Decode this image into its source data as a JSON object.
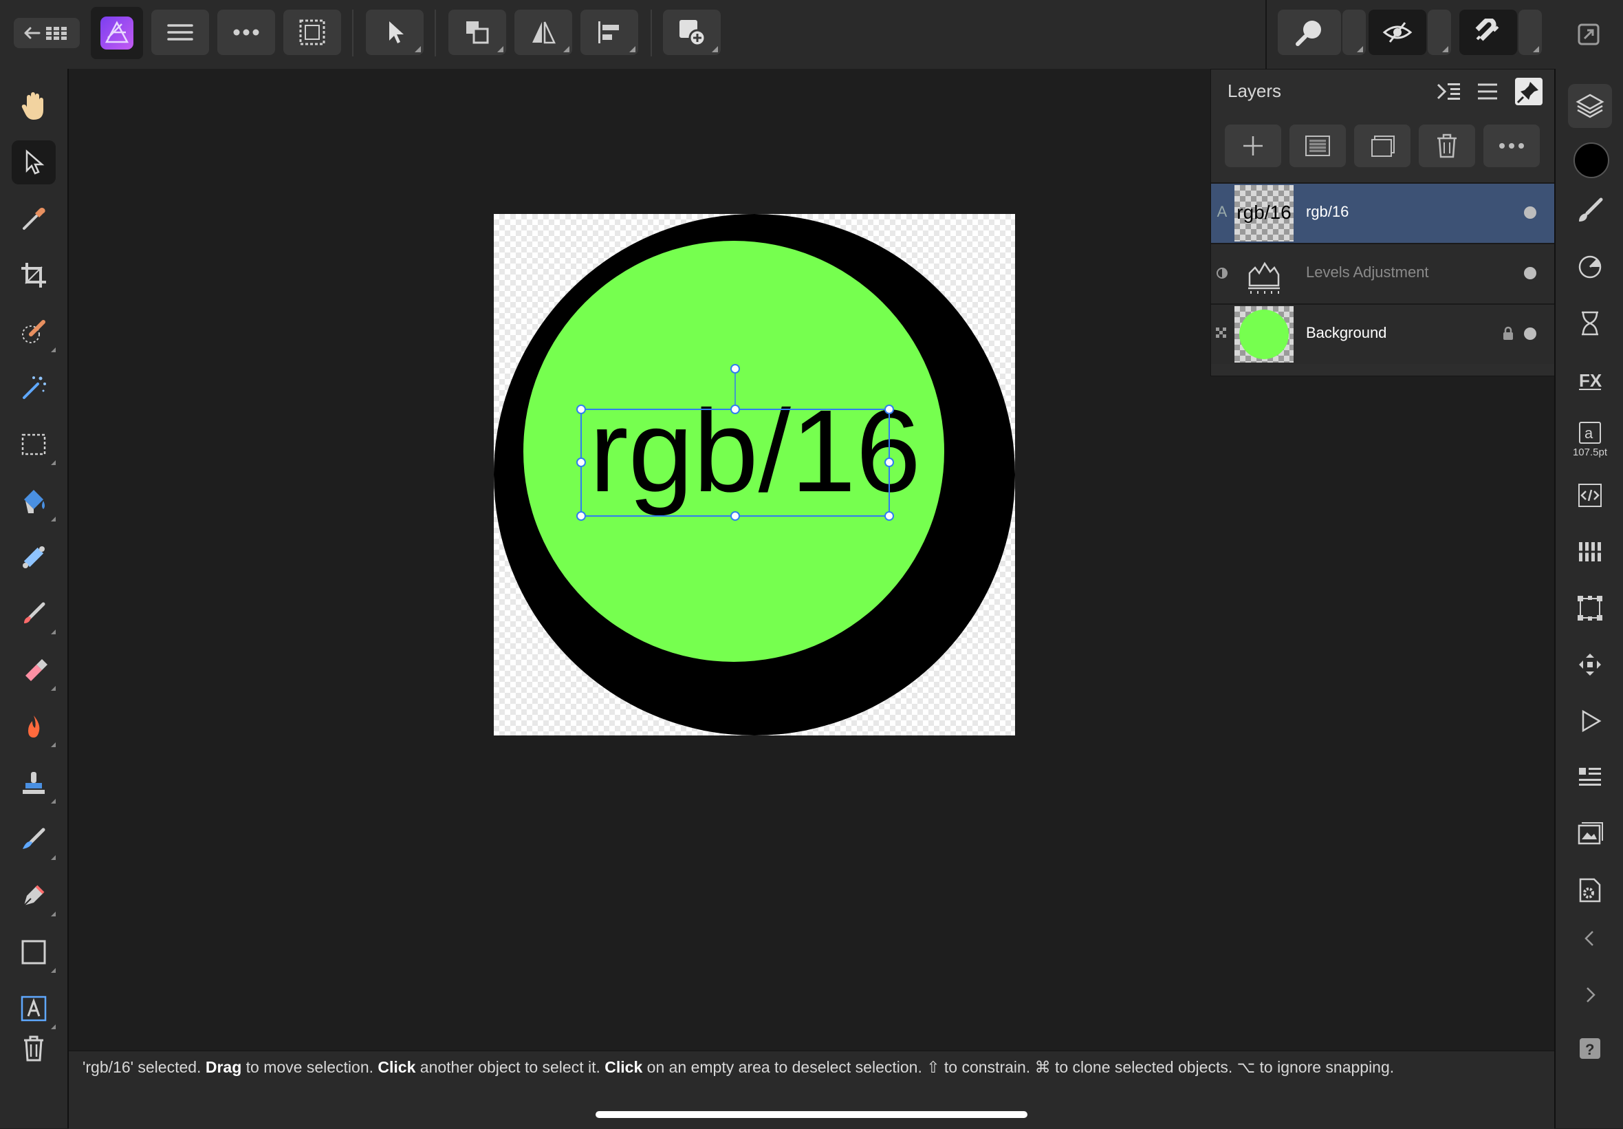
{
  "toolbar": {
    "right_groups": [
      "zoom-view",
      "view-quality",
      "snapping"
    ]
  },
  "tools_left": [
    "hand-icon",
    "move-tool-icon",
    "color-picker-icon",
    "crop-icon",
    "selection-brush-icon",
    "flood-select-icon",
    "marquee-icon",
    "flood-fill-icon",
    "gradient-icon",
    "paint-brush-icon",
    "erase-brush-icon",
    "dodge-icon",
    "clone-icon",
    "smudge-icon",
    "pen-icon",
    "rectangle-icon",
    "artistic-text-icon",
    "delete-icon"
  ],
  "studio_right": {
    "font_size": "107.5pt",
    "color_swatch": "#000000"
  },
  "layers_panel": {
    "title": "Layers",
    "layers": [
      {
        "name": "rgb/16",
        "type_badge": "A",
        "thumb_text": "rgb/16",
        "selected": true,
        "dim": false
      },
      {
        "name": "Levels Adjustment",
        "type_badge": "",
        "selected": false,
        "dim": true
      },
      {
        "name": "Background",
        "type_badge": "",
        "selected": false,
        "dim": false,
        "locked": true
      }
    ]
  },
  "canvas": {
    "text_layer": "rgb/16",
    "outer_color": "#000000",
    "inner_color": "#76ff4f",
    "selection_color": "#2f7cf0"
  },
  "status": {
    "line1_pre": "'rgb/16' selected. ",
    "drag": "Drag",
    "drag_text": " to move selection. ",
    "click1": "Click",
    "click1_text": " another object to select it. ",
    "click2": "Click",
    "click2_text": " on an empty area to deselect selection. ⇧ to constrain. ⌘ to clone selected objects. ⌥ to ignore snapping."
  }
}
